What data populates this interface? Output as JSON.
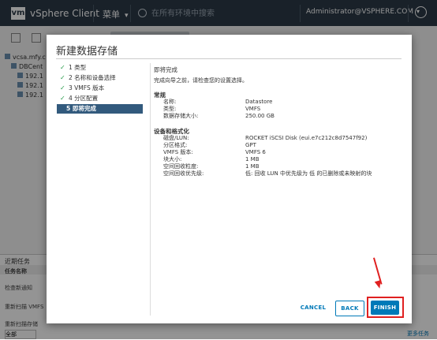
{
  "topbar": {
    "logo": "vm",
    "app_name": "vSphere Client",
    "menu_label": "菜单",
    "search_placeholder": "在所有环境中搜索",
    "user": "Administrator@VSPHERE.COM"
  },
  "tree": {
    "items": [
      "vcsa.mfy.c",
      "DBCent",
      "192.1",
      "192.1",
      "192.1"
    ]
  },
  "recent_tasks": {
    "tab_label": "近期任务",
    "col_task_name": "任务名称",
    "rows": [
      "检查新通知",
      "重新扫描 VMFS",
      "重新扫描存储"
    ],
    "filter_value": "全部",
    "more_link": "更多任务"
  },
  "modal": {
    "title": "新建数据存储",
    "steps": [
      {
        "num": "1",
        "label": "类型",
        "done": true
      },
      {
        "num": "2",
        "label": "名称和设备选择",
        "done": true
      },
      {
        "num": "3",
        "label": "VMFS 版本",
        "done": true
      },
      {
        "num": "4",
        "label": "分区配置",
        "done": true
      },
      {
        "num": "5",
        "label": "即将完成",
        "done": false,
        "active": true
      }
    ],
    "content": {
      "heading": "即将完成",
      "subheading": "完成向导之前，请检查您的设置选择。",
      "general_title": "常规",
      "general": [
        {
          "k": "名称:",
          "v": "Datastore"
        },
        {
          "k": "类型:",
          "v": "VMFS"
        },
        {
          "k": "数据存储大小:",
          "v": "250.00 GB"
        }
      ],
      "device_title": "设备和格式化",
      "device": [
        {
          "k": "磁盘/LUN:",
          "v": "ROCKET iSCSI Disk (eui.e7c212c8d7547f92)"
        },
        {
          "k": "分区格式:",
          "v": "GPT"
        },
        {
          "k": "VMFS 版本:",
          "v": "VMFS 6"
        },
        {
          "k": "块大小:",
          "v": "1 MB"
        },
        {
          "k": "空间回收粒度:",
          "v": "1 MB"
        },
        {
          "k": "空间回收优先级:",
          "v": "低: 回收 LUN 中优先级为 低 的已删除或未映射的块"
        }
      ]
    },
    "buttons": {
      "cancel": "CANCEL",
      "back": "BACK",
      "finish": "FINISH"
    },
    "annotation_color": "#e02020",
    "accent_color": "#0079b8"
  }
}
